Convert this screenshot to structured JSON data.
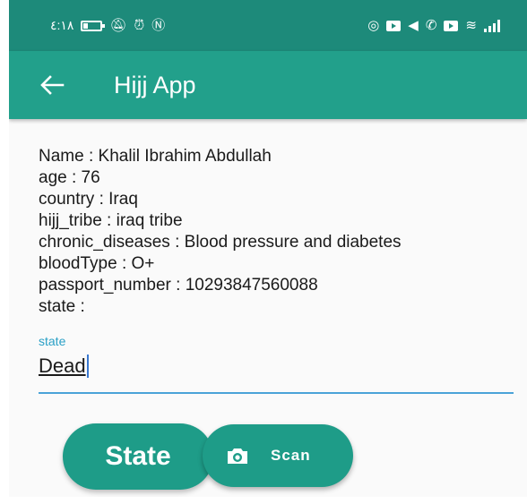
{
  "status_bar": {
    "time": "٤:١٨",
    "icons": [
      "battery-icon",
      "mute-icon",
      "alarm-icon",
      "nfc-icon",
      "instagram-icon",
      "youtube-icon",
      "telegram-icon",
      "whatsapp-icon",
      "youtube-icon",
      "wifi-icon",
      "signal-icon"
    ]
  },
  "app_bar": {
    "title": "Hijj App"
  },
  "details": {
    "name": "Name : Khalil Ibrahim Abdullah",
    "age": "age : 76",
    "country": "country : Iraq",
    "hijj_tribe": "hijj_tribe : iraq tribe",
    "chronic_diseases": "chronic_diseases : Blood pressure and diabetes",
    "blood_type": "bloodType : O+",
    "passport_number": "passport_number : 10293847560088",
    "state": "state :"
  },
  "state_field": {
    "label": "state",
    "value": "Dead"
  },
  "buttons": {
    "state_label": "State",
    "scan_label": "Scan"
  },
  "colors": {
    "status_bar": "#1d8a7a",
    "app_bar": "#22a08b",
    "button": "#1e9c88",
    "field_accent": "#4aa3d8"
  }
}
